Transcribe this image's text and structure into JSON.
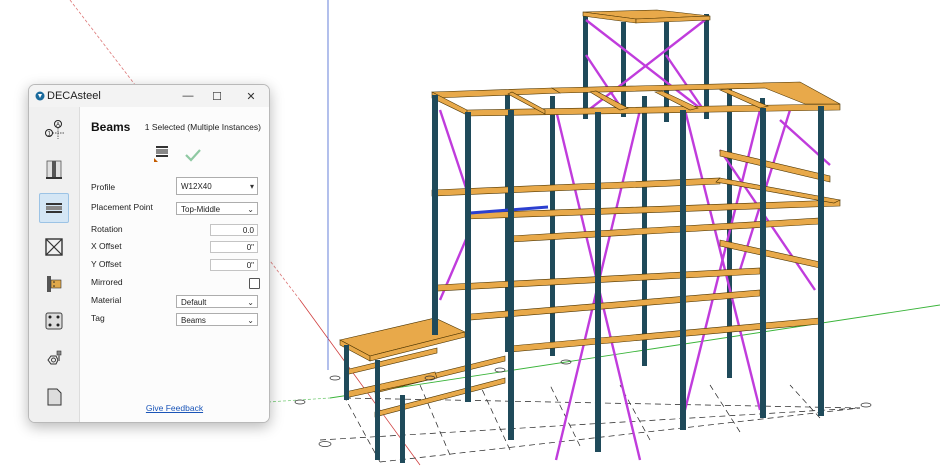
{
  "window": {
    "title": "DECAsteel",
    "controls": {
      "minimize": "—",
      "maximize": "☐",
      "close": "✕"
    }
  },
  "sidebar": {
    "items": [
      {
        "name": "grid-tool-icon",
        "active": false
      },
      {
        "name": "columns-tool-icon",
        "active": false
      },
      {
        "name": "beams-tool-icon",
        "active": true
      },
      {
        "name": "bracing-tool-icon",
        "active": false
      },
      {
        "name": "connection-tool-icon",
        "active": false
      },
      {
        "name": "base-plate-tool-icon",
        "active": false
      },
      {
        "name": "bolt-tool-icon",
        "active": false
      },
      {
        "name": "plate-tool-icon",
        "active": false
      }
    ]
  },
  "panel": {
    "heading": "Beams",
    "selection": "1 Selected (Multiple Instances)",
    "fields": {
      "profile": {
        "label": "Profile",
        "value": "W12X40"
      },
      "placement": {
        "label": "Placement Point",
        "value": "Top-Middle"
      },
      "rotation": {
        "label": "Rotation",
        "value": "0.0"
      },
      "x_offset": {
        "label": "X Offset",
        "value": "0\""
      },
      "y_offset": {
        "label": "Y Offset",
        "value": "0\""
      },
      "mirrored": {
        "label": "Mirrored",
        "checked": false
      },
      "material": {
        "label": "Material",
        "value": "Default"
      },
      "tag": {
        "label": "Tag",
        "value": "Beams"
      }
    },
    "feedback_link": "Give Feedback"
  },
  "colors": {
    "beam": "#e8a94a",
    "column": "#1f4a5a",
    "brace": "#c03cdc",
    "selected_beam": "#2b3fd0",
    "axis_green": "#3ab43a",
    "axis_red": "#d04040",
    "axis_blue": "#4060d0"
  }
}
